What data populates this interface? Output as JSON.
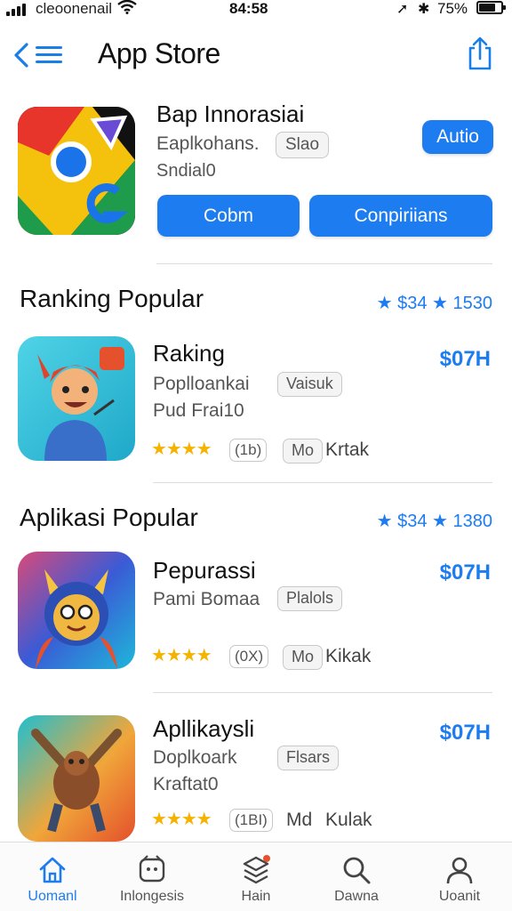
{
  "status_bar": {
    "carrier": "cleoonenail",
    "time": "84:58",
    "battery": "75%"
  },
  "nav": {
    "title": "App Store",
    "icons": [
      "back-icon",
      "menu-icon",
      "share-icon"
    ]
  },
  "featured": {
    "title": "Bap Innorasiai",
    "subtitle": "Eaplkohans.",
    "tag": "Slao",
    "meta": "Sndial0",
    "action": "Autio",
    "button1": "Cobm",
    "button2": "Conpiriians"
  },
  "sections": [
    {
      "title": "Ranking Popular",
      "meta": "★ $34 ★ 1530",
      "items": [
        {
          "title": "Raking",
          "subtitle": "Poplloankai",
          "tag": "Vaisuk",
          "meta": "Pud Frai10",
          "price": "$07H",
          "stars": "★★★★",
          "rating": "(1b)",
          "extra_tag": "Mo",
          "extra": "Krtak"
        }
      ]
    },
    {
      "title": "Aplikasi Popular",
      "meta": "★ $34 ★ 1380",
      "items": [
        {
          "title": "Pepurassi",
          "subtitle": "Pami Bomaa",
          "tag": "Plalols",
          "meta": "",
          "price": "$07H",
          "stars": "★★★★",
          "rating": "(0X)",
          "extra_tag": "Mo",
          "extra": "Kikak"
        },
        {
          "title": "Apllikaysli",
          "subtitle": "Doplkoark",
          "tag": "Flsars",
          "meta": "Kraftat0",
          "price": "$07H",
          "stars": "★★★★",
          "rating": "(1BI)",
          "extra_tag": "Md",
          "extra": "Kulak"
        }
      ]
    }
  ],
  "tabbar": {
    "tabs": [
      {
        "label": "Uomanl",
        "icon": "home-icon",
        "active": true
      },
      {
        "label": "Inlongesis",
        "icon": "games-icon",
        "active": false
      },
      {
        "label": "Hain",
        "icon": "apps-icon",
        "active": false
      },
      {
        "label": "Dawna",
        "icon": "search-icon",
        "active": false
      },
      {
        "label": "Uoanit",
        "icon": "account-icon",
        "active": false
      }
    ]
  },
  "colors": {
    "accent": "#1d7cf0",
    "star": "#f5b301",
    "divider": "#dddddd"
  }
}
